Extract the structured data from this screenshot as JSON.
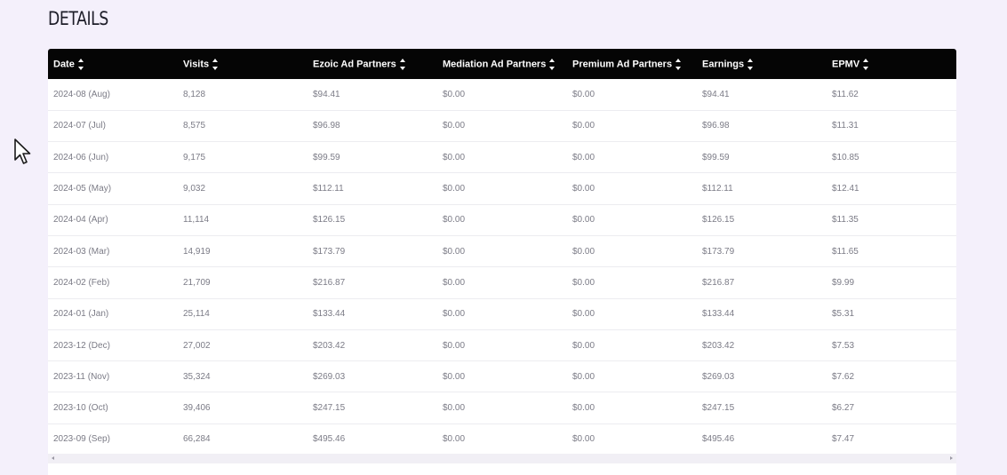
{
  "page": {
    "title": "DETAILS"
  },
  "table": {
    "columns": [
      "Date",
      "Visits",
      "Ezoic Ad Partners",
      "Mediation Ad Partners",
      "Premium Ad Partners",
      "Earnings",
      "EPMV"
    ],
    "rows": [
      [
        "2024-08 (Aug)",
        "8,128",
        "$94.41",
        "$0.00",
        "$0.00",
        "$94.41",
        "$11.62"
      ],
      [
        "2024-07 (Jul)",
        "8,575",
        "$96.98",
        "$0.00",
        "$0.00",
        "$96.98",
        "$11.31"
      ],
      [
        "2024-06 (Jun)",
        "9,175",
        "$99.59",
        "$0.00",
        "$0.00",
        "$99.59",
        "$10.85"
      ],
      [
        "2024-05 (May)",
        "9,032",
        "$112.11",
        "$0.00",
        "$0.00",
        "$112.11",
        "$12.41"
      ],
      [
        "2024-04 (Apr)",
        "11,114",
        "$126.15",
        "$0.00",
        "$0.00",
        "$126.15",
        "$11.35"
      ],
      [
        "2024-03 (Mar)",
        "14,919",
        "$173.79",
        "$0.00",
        "$0.00",
        "$173.79",
        "$11.65"
      ],
      [
        "2024-02 (Feb)",
        "21,709",
        "$216.87",
        "$0.00",
        "$0.00",
        "$216.87",
        "$9.99"
      ],
      [
        "2024-01 (Jan)",
        "25,114",
        "$133.44",
        "$0.00",
        "$0.00",
        "$133.44",
        "$5.31"
      ],
      [
        "2023-12 (Dec)",
        "27,002",
        "$203.42",
        "$0.00",
        "$0.00",
        "$203.42",
        "$7.53"
      ],
      [
        "2023-11 (Nov)",
        "35,324",
        "$269.03",
        "$0.00",
        "$0.00",
        "$269.03",
        "$7.62"
      ],
      [
        "2023-10 (Oct)",
        "39,406",
        "$247.15",
        "$0.00",
        "$0.00",
        "$247.15",
        "$6.27"
      ],
      [
        "2023-09 (Sep)",
        "66,284",
        "$495.46",
        "$0.00",
        "$0.00",
        "$495.46",
        "$7.47"
      ]
    ]
  },
  "icons": {
    "sort": "sort-icon",
    "cursor": "mouse-pointer-icon"
  },
  "colors": {
    "header_bg": "#050505",
    "page_bg": "#f4f0fb",
    "cell_text": "#7b7b86"
  }
}
